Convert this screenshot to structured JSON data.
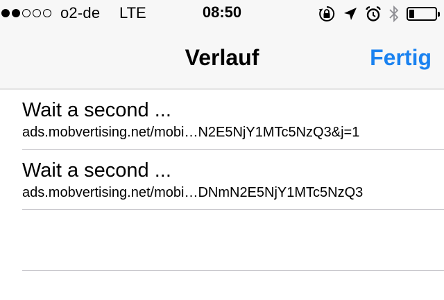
{
  "status_bar": {
    "signal_bars_filled": 2,
    "signal_bars_total": 5,
    "carrier": "o2-de",
    "network": "LTE",
    "time": "08:50",
    "icons": [
      "orientation-lock-icon",
      "location-arrow-icon",
      "alarm-icon",
      "bluetooth-icon",
      "battery-icon"
    ],
    "battery_level": 0.2
  },
  "navbar": {
    "title": "Verlauf",
    "done_label": "Fertig",
    "accent_color": "#1a82f0"
  },
  "history": {
    "items": [
      {
        "title": "Wait a second ...",
        "url": "ads.mobvertising.net/mobi…N2E5NjY1MTc5NzQ3&j=1"
      },
      {
        "title": "Wait a second ...",
        "url": "ads.mobvertising.net/mobi…DNmN2E5NjY1MTc5NzQ3"
      }
    ]
  }
}
